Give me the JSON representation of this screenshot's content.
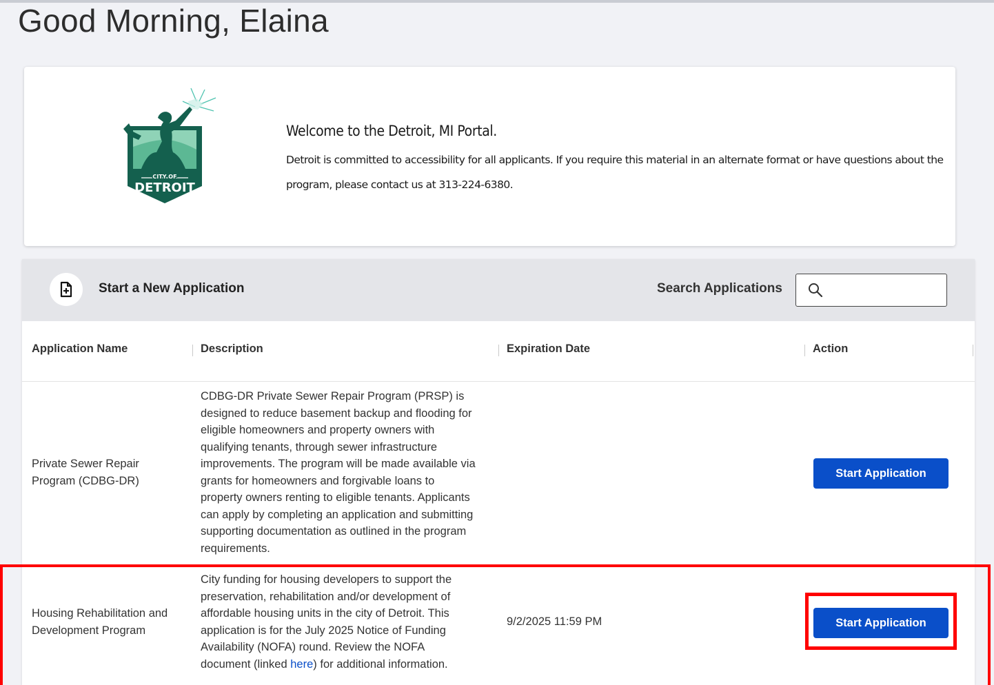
{
  "greeting": "Good Morning, Elaina",
  "welcome": {
    "title": "Welcome to the Detroit, MI Portal.",
    "text": "Detroit is committed to accessibility for all applicants. If you require this material in an alternate format or have questions about the program, please contact us at 313-224-6380.",
    "logo": {
      "top_text": "CITY OF",
      "name": "DETROIT"
    }
  },
  "toolbar": {
    "new_application_label": "Start a New Application",
    "search_label": "Search Applications",
    "search_value": ""
  },
  "table": {
    "columns": [
      "Application Name",
      "Description",
      "Expiration Date",
      "Action"
    ],
    "rows": [
      {
        "name": "Private Sewer Repair Program (CDBG-DR)",
        "description": "CDBG-DR Private Sewer Repair Program (PRSP) is designed to reduce basement backup and flooding for eligible homeowners and property owners with qualifying tenants, through sewer infrastructure improvements. The program will be made available via grants for homeowners and forgivable loans to property owners renting to eligible tenants. Applicants can apply by completing an application and submitting supporting documentation as outlined in the program requirements.",
        "expiration": "",
        "action": "Start Application"
      },
      {
        "name": "Housing Rehabilitation and Development Program",
        "description_before_link": "City funding for housing developers to support the preservation, rehabilitation and/or development of affordable housing units in the city of Detroit. This application is for the July 2025 Notice of Funding Availability (NOFA) round. Review the NOFA document (linked ",
        "description_link": "here",
        "description_after_link": ") for additional information.",
        "expiration": "9/2/2025 11:59 PM",
        "action": "Start Application"
      }
    ]
  },
  "colors": {
    "primary_button": "#0a4fc9",
    "highlight": "#ff0000",
    "logo_green": "#1f7a63"
  }
}
